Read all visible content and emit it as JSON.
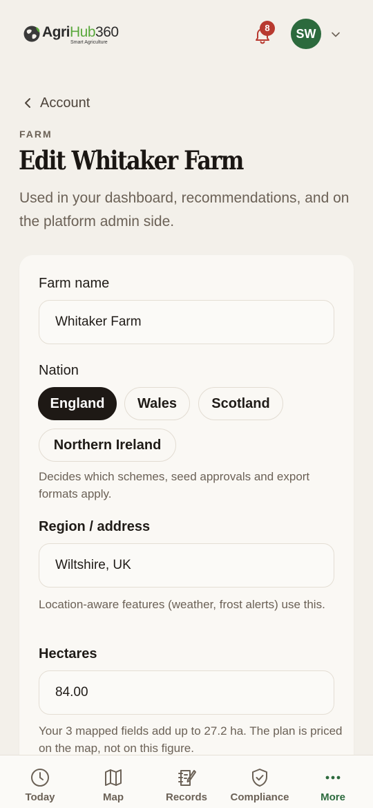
{
  "header": {
    "logo": {
      "word_agri": "Agri",
      "word_hub": "Hub",
      "word_num": "360",
      "tagline": "Smart Agriculture"
    },
    "notifications": {
      "icon": "bell-icon",
      "count": "8"
    },
    "avatar": {
      "initials": "SW",
      "color": "#2c6a3d"
    },
    "menu_icon": "chevron-down-icon"
  },
  "breadcrumb": {
    "label": "Account",
    "icon": "chevron-left-icon"
  },
  "eyebrow": "FARM",
  "title": "Edit Whitaker Farm",
  "subtitle": "Used in your dashboard, recommendations, and on the platform admin side.",
  "form": {
    "farm_name": {
      "label": "Farm name",
      "value": "Whitaker Farm"
    },
    "nation": {
      "label": "Nation",
      "options": [
        "England",
        "Wales",
        "Scotland",
        "Northern Ireland"
      ],
      "selected": "England",
      "help": "Decides which schemes, seed approvals and export formats apply."
    },
    "region": {
      "label": "Region / address",
      "value": "Wiltshire, UK",
      "help": "Location-aware features (weather, frost alerts) use this."
    },
    "hectares": {
      "label": "Hectares",
      "value": "84.00",
      "help": "Your 3 mapped fields add up to 27.2 ha. The plan is priced on the map, not on this figure."
    }
  },
  "bottom_nav": {
    "items": [
      {
        "label": "Today",
        "icon": "clock-icon"
      },
      {
        "label": "Map",
        "icon": "map-icon"
      },
      {
        "label": "Records",
        "icon": "notebook-icon"
      },
      {
        "label": "Compliance",
        "icon": "shield-check-icon"
      },
      {
        "label": "More",
        "icon": "more-dots-icon"
      }
    ],
    "active": "More",
    "accent": "#2c6a3d"
  }
}
